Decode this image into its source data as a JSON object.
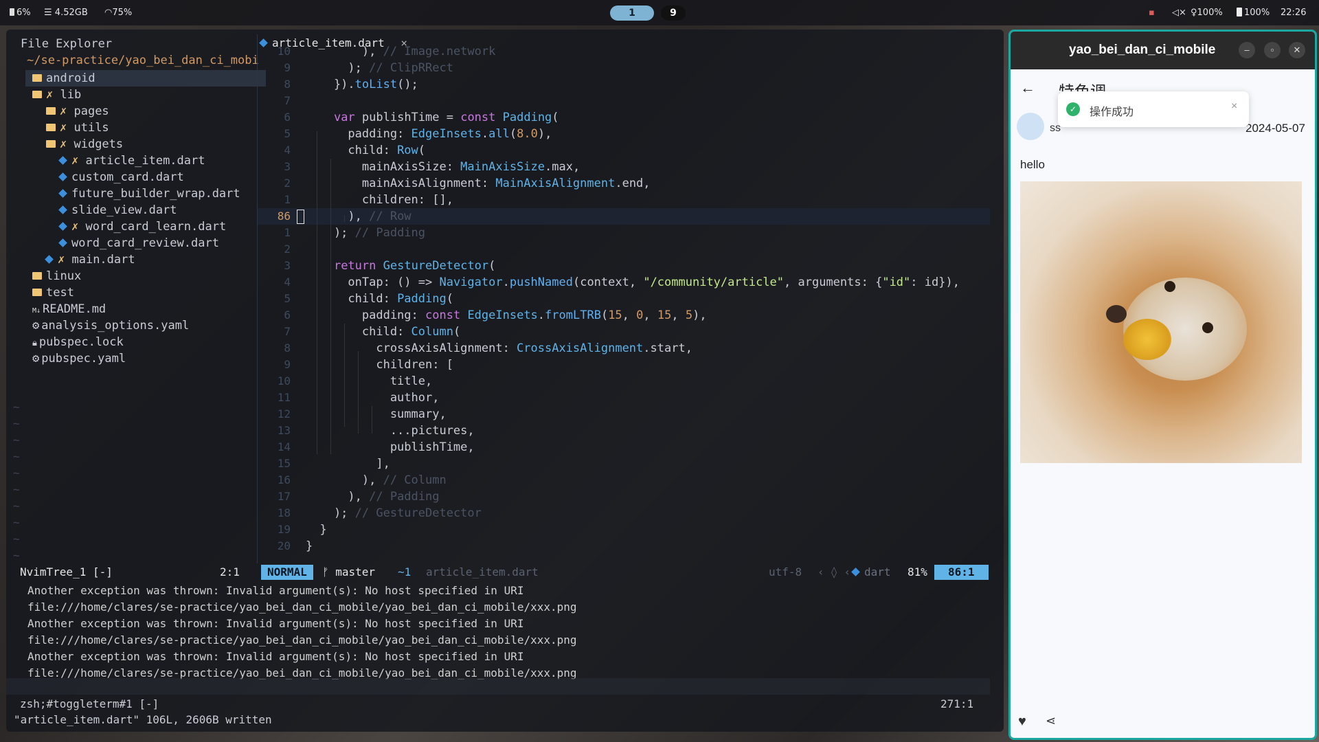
{
  "topbar": {
    "cpu": "6%",
    "memory": "4.52GB",
    "wifi": "75%",
    "workspaces": [
      "1",
      "9"
    ],
    "volume": "100%",
    "brightness": "100%",
    "battery": "100%",
    "clock": "22:26"
  },
  "tree": {
    "title": "File Explorer",
    "root": "~/se-practice/yao_bei_dan_ci_mobi",
    "items": [
      {
        "name": "android",
        "kind": "folder",
        "depth": 0,
        "mark": ""
      },
      {
        "name": "lib",
        "kind": "folder",
        "depth": 0,
        "mark": "✗"
      },
      {
        "name": "pages",
        "kind": "folder",
        "depth": 1,
        "mark": "✗"
      },
      {
        "name": "utils",
        "kind": "folder",
        "depth": 1,
        "mark": "✗"
      },
      {
        "name": "widgets",
        "kind": "folder",
        "depth": 1,
        "mark": "✗"
      },
      {
        "name": "article_item.dart",
        "kind": "dart",
        "depth": 2,
        "mark": "✗"
      },
      {
        "name": "custom_card.dart",
        "kind": "dart",
        "depth": 2,
        "mark": ""
      },
      {
        "name": "future_builder_wrap.dart",
        "kind": "dart",
        "depth": 2,
        "mark": ""
      },
      {
        "name": "slide_view.dart",
        "kind": "dart",
        "depth": 2,
        "mark": ""
      },
      {
        "name": "word_card_learn.dart",
        "kind": "dart",
        "depth": 2,
        "mark": "✗"
      },
      {
        "name": "word_card_review.dart",
        "kind": "dart",
        "depth": 2,
        "mark": ""
      },
      {
        "name": "main.dart",
        "kind": "dart",
        "depth": 1,
        "mark": "✗"
      },
      {
        "name": "linux",
        "kind": "folder",
        "depth": 0,
        "mark": ""
      },
      {
        "name": "test",
        "kind": "folder",
        "depth": 0,
        "mark": ""
      },
      {
        "name": "README.md",
        "kind": "md",
        "depth": 0,
        "mark": ""
      },
      {
        "name": "analysis_options.yaml",
        "kind": "gear",
        "depth": 0,
        "mark": ""
      },
      {
        "name": "pubspec.lock",
        "kind": "lock",
        "depth": 0,
        "mark": ""
      },
      {
        "name": "pubspec.yaml",
        "kind": "gear",
        "depth": 0,
        "mark": ""
      }
    ]
  },
  "tab": {
    "filename": "article_item.dart",
    "close": "×"
  },
  "code": {
    "lines": [
      {
        "n": "10",
        "t": "        ), // Image.network"
      },
      {
        "n": "9",
        "t": "      ); // ClipRRect"
      },
      {
        "n": "8",
        "t": "    }).toList();"
      },
      {
        "n": "7",
        "t": ""
      },
      {
        "n": "6",
        "t": "    var publishTime = const Padding("
      },
      {
        "n": "5",
        "t": "      padding: EdgeInsets.all(8.0),"
      },
      {
        "n": "4",
        "t": "      child: Row("
      },
      {
        "n": "3",
        "t": "        mainAxisSize: MainAxisSize.max,"
      },
      {
        "n": "2",
        "t": "        mainAxisAlignment: MainAxisAlignment.end,"
      },
      {
        "n": "1",
        "t": "        children: [],"
      },
      {
        "n": "86",
        "t": "      ), // Row"
      },
      {
        "n": "1",
        "t": "    ); // Padding"
      },
      {
        "n": "2",
        "t": ""
      },
      {
        "n": "3",
        "t": "    return GestureDetector("
      },
      {
        "n": "4",
        "t": "      onTap: () => Navigator.pushNamed(context, \"/community/article\", arguments: {\"id\": id}),"
      },
      {
        "n": "5",
        "t": "      child: Padding("
      },
      {
        "n": "6",
        "t": "        padding: const EdgeInsets.fromLTRB(15, 0, 15, 5),"
      },
      {
        "n": "7",
        "t": "        child: Column("
      },
      {
        "n": "8",
        "t": "          crossAxisAlignment: CrossAxisAlignment.start,"
      },
      {
        "n": "9",
        "t": "          children: ["
      },
      {
        "n": "10",
        "t": "            title,"
      },
      {
        "n": "11",
        "t": "            author,"
      },
      {
        "n": "12",
        "t": "            summary,"
      },
      {
        "n": "13",
        "t": "            ...pictures,"
      },
      {
        "n": "14",
        "t": "            publishTime,"
      },
      {
        "n": "15",
        "t": "          ],"
      },
      {
        "n": "16",
        "t": "        ), // Column"
      },
      {
        "n": "17",
        "t": "      ), // Padding"
      },
      {
        "n": "18",
        "t": "    ); // GestureDetector"
      },
      {
        "n": "19",
        "t": "  }"
      },
      {
        "n": "20",
        "t": "}"
      }
    ],
    "current_line_index": 10
  },
  "statusline": {
    "tree_name": "NvimTree_1 [-]",
    "tree_pos": "2:1",
    "mode": "NORMAL",
    "branch": "master",
    "diff": "~1",
    "file": "article_item.dart",
    "encoding": "utf-8",
    "filetype": "dart",
    "percent": "81%",
    "position": "86:1"
  },
  "terminal": {
    "lines": [
      "Another exception was thrown: Invalid argument(s): No host specified in URI",
      "file:///home/clares/se-practice/yao_bei_dan_ci_mobile/yao_bei_dan_ci_mobile/xxx.png",
      "Another exception was thrown: Invalid argument(s): No host specified in URI",
      "file:///home/clares/se-practice/yao_bei_dan_ci_mobile/yao_bei_dan_ci_mobile/xxx.png",
      "Another exception was thrown: Invalid argument(s): No host specified in URI",
      "file:///home/clares/se-practice/yao_bei_dan_ci_mobile/yao_bei_dan_ci_mobile/xxx.png"
    ],
    "status_name": "zsh;#toggleterm#1 [-]",
    "status_pos": "271:1"
  },
  "message": "\"article_item.dart\" 106L, 2606B written",
  "phone": {
    "window_title": "yao_bei_dan_ci_mobile",
    "page_title": "特色调",
    "toast": "操作成功",
    "toast_close": "×",
    "author": "ss",
    "date": "2024-05-07",
    "body": "hello",
    "accent_color": "#1aa8a0",
    "success_color": "#2fb36a"
  }
}
